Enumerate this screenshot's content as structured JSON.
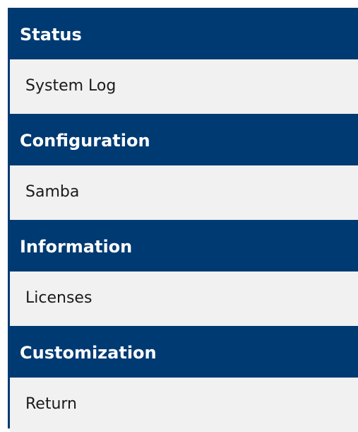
{
  "menu": {
    "sections": [
      {
        "header": "Status",
        "item": "System Log"
      },
      {
        "header": "Configuration",
        "item": "Samba"
      },
      {
        "header": "Information",
        "item": "Licenses"
      },
      {
        "header": "Customization",
        "item": "Return"
      }
    ]
  },
  "colors": {
    "header_bg": "#003a73",
    "header_text": "#ffffff",
    "item_bg": "#f1f1f1",
    "item_text": "#1a1a1a"
  }
}
